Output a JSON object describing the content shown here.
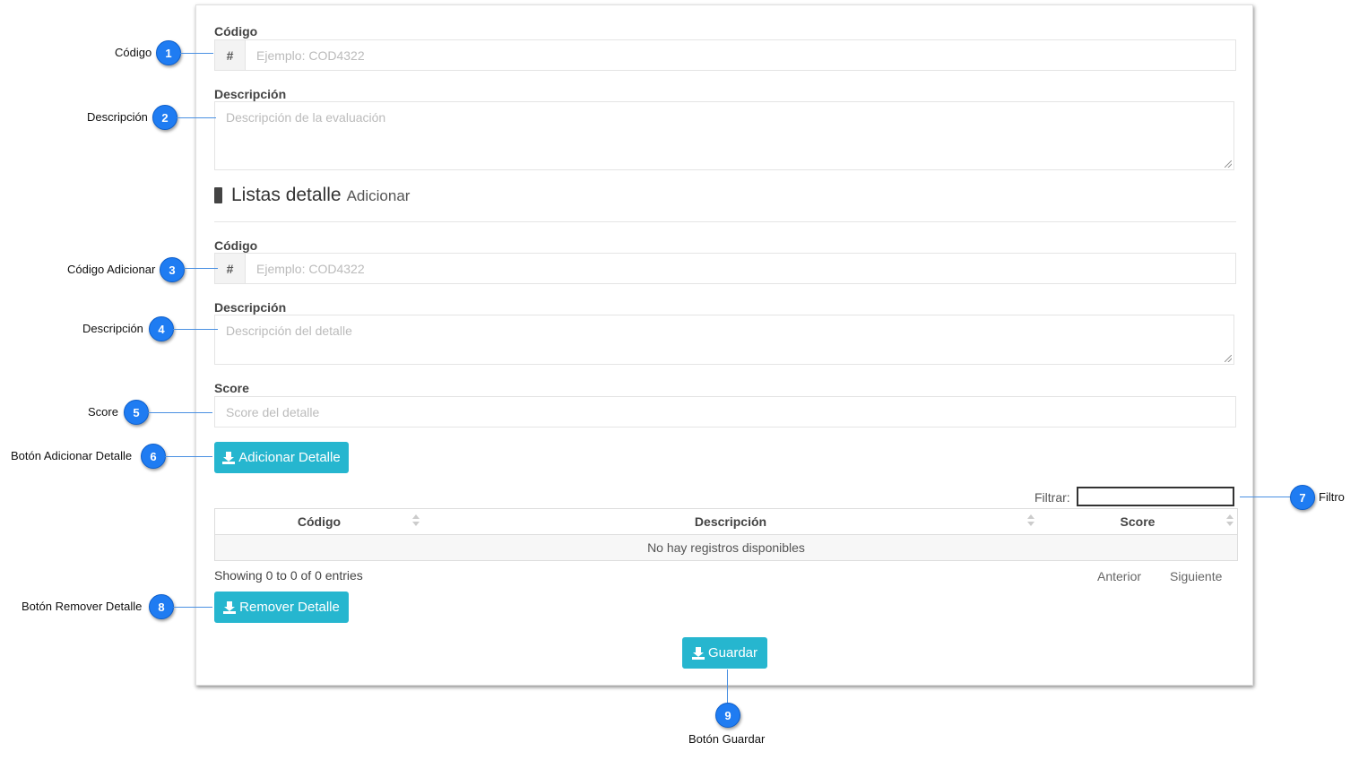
{
  "form": {
    "codigo_label": "Código",
    "codigo_addon": "#",
    "codigo_placeholder": "Ejemplo: COD4322",
    "descripcion_label": "Descripción",
    "descripcion_placeholder": "Descripción de la evaluación"
  },
  "section": {
    "title": "Listas detalle",
    "subtitle": "Adicionar",
    "icon": "book-icon"
  },
  "detail": {
    "codigo_label": "Código",
    "codigo_addon": "#",
    "codigo_placeholder": "Ejemplo: COD4322",
    "descripcion_label": "Descripción",
    "descripcion_placeholder": "Descripción del detalle",
    "score_label": "Score",
    "score_placeholder": "Score del detalle",
    "add_button": "Adicionar Detalle"
  },
  "table": {
    "filter_label": "Filtrar:",
    "columns": [
      "Código",
      "Descripción",
      "Score"
    ],
    "empty_message": "No hay registros disponibles",
    "info": "Showing 0 to 0 of 0 entries",
    "prev": "Anterior",
    "next": "Siguiente"
  },
  "buttons": {
    "remove": "Remover Detalle",
    "save": "Guardar"
  },
  "callouts": [
    {
      "num": "1",
      "label": "Código"
    },
    {
      "num": "2",
      "label": "Descripción"
    },
    {
      "num": "3",
      "label": "Código Adicionar"
    },
    {
      "num": "4",
      "label": "Descripción"
    },
    {
      "num": "5",
      "label": "Score"
    },
    {
      "num": "6",
      "label": "Botón  Adicionar Detalle"
    },
    {
      "num": "7",
      "label": "Filtro"
    },
    {
      "num": "8",
      "label": "Botón  Remover Detalle"
    },
    {
      "num": "9",
      "label": "Botón  Guardar"
    }
  ],
  "colors": {
    "accent": "#26b6cf",
    "callout": "#1f7cf2"
  }
}
